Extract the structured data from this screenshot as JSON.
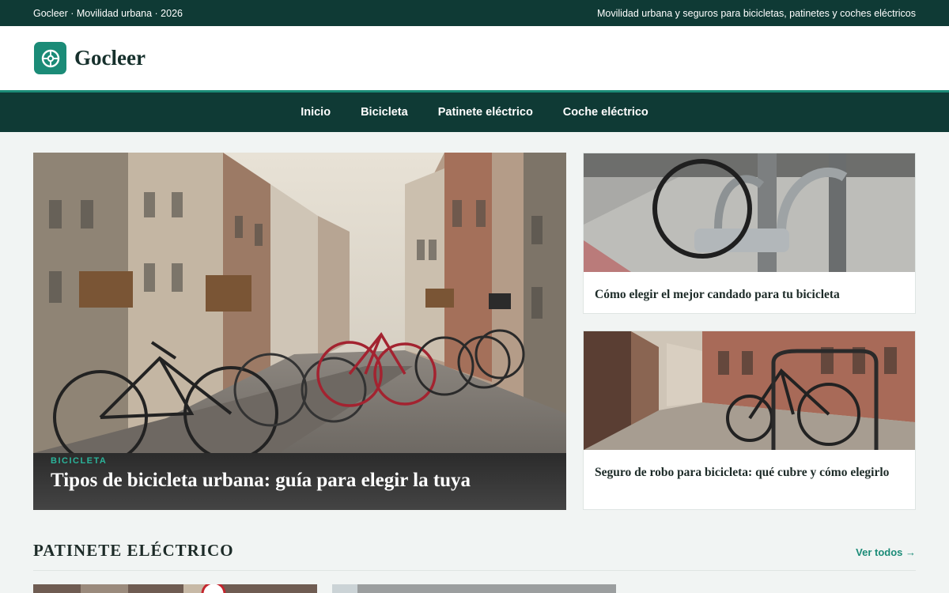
{
  "topbar": {
    "left_text": "Gocleer · Movilidad urbana · 2026",
    "right_text": "Movilidad urbana y seguros para bicicletas, patinetes y coches eléctricos"
  },
  "brand": {
    "name": "Gocleer",
    "icon": "compass-icon",
    "color": "#1b8b77"
  },
  "nav": {
    "items": [
      "Inicio",
      "Bicicleta",
      "Patinete eléctrico",
      "Coche eléctrico"
    ]
  },
  "hero": {
    "category": "BICICLETA",
    "title": "Tipos de bicicleta urbana: guía para elegir la tuya"
  },
  "side_articles": [
    {
      "title": "Cómo elegir el mejor candado para tu bicicleta"
    },
    {
      "title": "Seguro de robo para bicicleta: qué cubre y cómo elegirlo"
    }
  ],
  "section": {
    "title": "PATINETE ELÉCTRICO",
    "see_all": "Ver todos →"
  },
  "colors": {
    "dark": "#0f3a35",
    "accent": "#1b8b77",
    "accent_light": "#2bb39a",
    "background": "#f1f4f3"
  }
}
